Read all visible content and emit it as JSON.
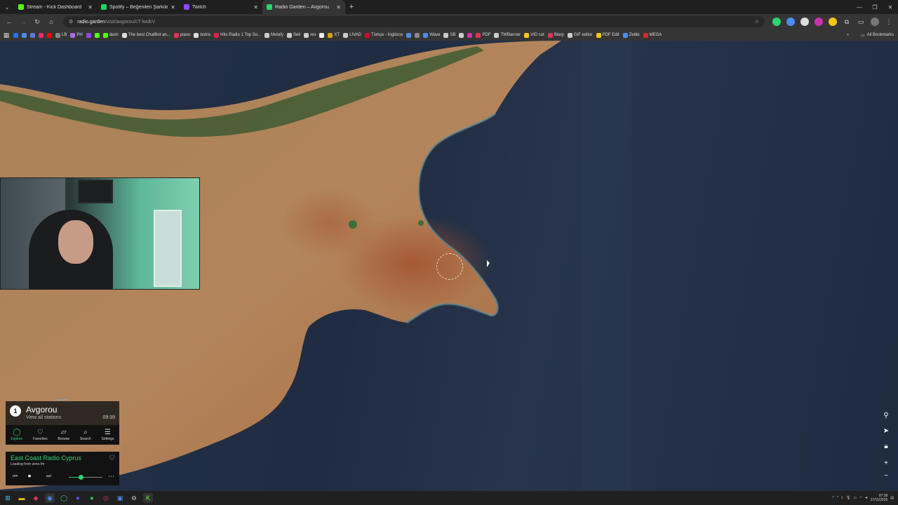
{
  "browser": {
    "tabs": [
      {
        "title": "Stream - Kick Dashboard",
        "color": "#53fc18",
        "active": false
      },
      {
        "title": "Spotify – Beğenilen Şarkılar",
        "color": "#1ed760",
        "active": false
      },
      {
        "title": "Twitch",
        "color": "#9146ff",
        "active": false
      },
      {
        "title": "Radio Garden – Avgorou",
        "color": "#2dd36f",
        "active": true
      }
    ],
    "url_host": "radio.garden",
    "url_path": "/visit/avgorou/cT-lwdkV",
    "bookmarks": [
      {
        "label": "",
        "color": "#1877f2"
      },
      {
        "label": "",
        "color": "#4c8bf5"
      },
      {
        "label": "",
        "color": "#5b7bd5"
      },
      {
        "label": "",
        "color": "#e1306c"
      },
      {
        "label": "",
        "color": "#ff0000"
      },
      {
        "label": "LB",
        "color": "#888888"
      },
      {
        "label": "PH",
        "color": "#aa66ff"
      },
      {
        "label": "",
        "color": "#9146ff"
      },
      {
        "label": "",
        "color": "#53fc18"
      },
      {
        "label": "dash",
        "color": "#53fc18"
      },
      {
        "label": "The best ChatBot an...",
        "color": "#dddddd"
      },
      {
        "label": "piano",
        "color": "#e03355"
      },
      {
        "label": "botrix",
        "color": "#dddddd"
      },
      {
        "label": "Hits Radio 1 Top So...",
        "color": "#e0204a"
      },
      {
        "label": "Metafy",
        "color": "#cccccc"
      },
      {
        "label": "Sell",
        "color": "#cccccc"
      },
      {
        "label": "rev",
        "color": "#cccccc"
      },
      {
        "label": "",
        "color": "#eeeeee"
      },
      {
        "label": "XT",
        "color": "#d4a017"
      },
      {
        "label": "LIVAD",
        "color": "#cccccc"
      },
      {
        "label": "Türkçe - İngilizce",
        "color": "#c8102e"
      },
      {
        "label": "",
        "color": "#4c8bf5"
      },
      {
        "label": "",
        "color": "#888888"
      },
      {
        "label": "Wave",
        "color": "#4c8bf5"
      },
      {
        "label": "SB",
        "color": "#cccccc"
      },
      {
        "label": "",
        "color": "#cccccc"
      },
      {
        "label": "",
        "color": "#cc33aa"
      },
      {
        "label": "PDF",
        "color": "#e03355"
      },
      {
        "label": "TWBanner",
        "color": "#cccccc"
      },
      {
        "label": "VID cut",
        "color": "#f5c518"
      },
      {
        "label": "Bierp",
        "color": "#e03355"
      },
      {
        "label": "GIF editor",
        "color": "#cccccc"
      },
      {
        "label": "PDF Edit",
        "color": "#f5c518"
      },
      {
        "label": "Zettle",
        "color": "#4c8bf5"
      },
      {
        "label": "MEGA",
        "color": "#d9272e"
      }
    ],
    "all_bookmarks_label": "All Bookmarks"
  },
  "radio_garden": {
    "station_count": "1",
    "place": "Avgorou",
    "view_all_label": "View all stations",
    "local_time": "09:39",
    "nav": [
      {
        "label": "Explore",
        "icon": "explore-icon",
        "glyph": "◯",
        "active": true
      },
      {
        "label": "Favorites",
        "icon": "heart-icon",
        "glyph": "♡",
        "active": false
      },
      {
        "label": "Browse",
        "icon": "map-icon",
        "glyph": "▱",
        "active": false
      },
      {
        "label": "Search",
        "icon": "search-icon",
        "glyph": "⌕",
        "active": false
      },
      {
        "label": "Settings",
        "icon": "menu-icon",
        "glyph": "☰",
        "active": false
      }
    ],
    "player": {
      "station": "East Coast Radio Cyprus",
      "status": "Loading from zeno.fm",
      "volume": 0.35
    }
  },
  "taskbar": {
    "time": "07:39",
    "date": "17/11/2025"
  },
  "colors": {
    "accent": "#2dd36f",
    "sea": "#233147",
    "land": "#b0825a"
  }
}
